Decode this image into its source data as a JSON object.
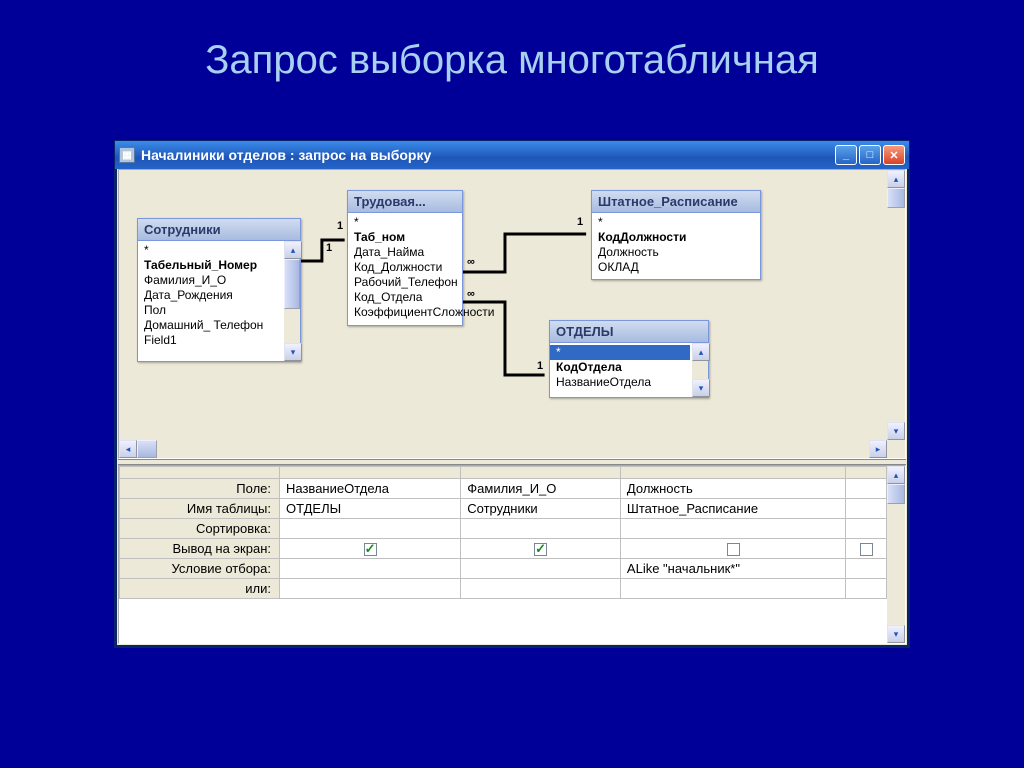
{
  "slide_title": "Запрос выборка многотабличная",
  "window_title": "Началиники отделов : запрос на выборку",
  "tables": {
    "employees": {
      "title": "Сотрудники",
      "fields": [
        "*",
        "Табельный_Номер",
        "Фамилия_И_О",
        "Дата_Рождения",
        "Пол",
        "Домашний_ Телефон",
        "Field1"
      ],
      "pk_index": 1
    },
    "labor": {
      "title": "Трудовая...",
      "fields": [
        "*",
        "Таб_ном",
        "Дата_Найма",
        "Код_Должности",
        "Рабочий_Телефон",
        "Код_Отдела",
        "КоэффициентСложности"
      ],
      "pk_index": 1
    },
    "staffing": {
      "title": "Штатное_Расписание",
      "fields": [
        "*",
        "КодДолжности",
        "Должность",
        "ОКЛАД"
      ],
      "pk_index": 1
    },
    "departments": {
      "title": "ОТДЕЛЫ",
      "fields": [
        "*",
        "КодОтдела",
        "НазваниеОтдела"
      ],
      "pk_index": 1
    }
  },
  "relationships": {
    "one": "1",
    "many": "∞"
  },
  "grid": {
    "row_labels": {
      "field": "Поле:",
      "table": "Имя таблицы:",
      "sort": "Сортировка:",
      "show": "Вывод на экран:",
      "criteria": "Условие отбора:",
      "or": "или:"
    },
    "columns": [
      {
        "field": "НазваниеОтдела",
        "table": "ОТДЕЛЫ",
        "sort": "",
        "show": true,
        "criteria": "",
        "or": ""
      },
      {
        "field": "Фамилия_И_О",
        "table": "Сотрудники",
        "sort": "",
        "show": true,
        "criteria": "",
        "or": ""
      },
      {
        "field": "Должность",
        "table": "Штатное_Расписание",
        "sort": "",
        "show": false,
        "criteria": "ALike \"начальник*\"",
        "or": ""
      }
    ]
  }
}
